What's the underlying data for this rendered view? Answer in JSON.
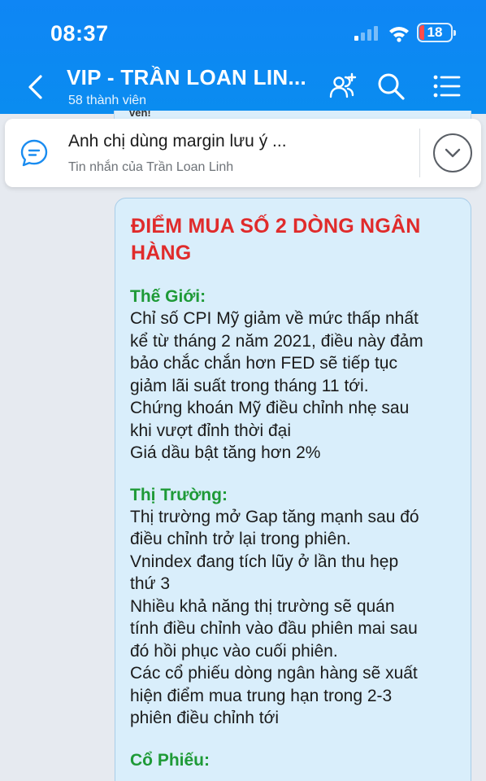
{
  "status_bar": {
    "time": "08:37",
    "battery": "18",
    "icons": [
      "cellular-signal-icon",
      "wifi-icon",
      "battery-icon"
    ]
  },
  "header": {
    "back_icon": "chevron-left-icon",
    "title": "VIP - TRẦN LOAN LIN...",
    "subtitle": "58 thành viên",
    "actions": [
      "add-member-icon",
      "search-icon",
      "menu-icon"
    ],
    "color": "#0f86f5"
  },
  "pinned_message": {
    "peek_text": "veh!",
    "text": "Anh chị dùng margin lưu ý ...",
    "sender": "Tin nhắn của Trần Loan Linh",
    "icon": "chat-bubble-icon",
    "expand_icon": "chevron-down-icon"
  },
  "message": {
    "title": "ĐIỂM MUA SỐ 2 DÒNG NGÂN HÀNG",
    "title_color": "#e02b2b",
    "section_color": "#1e9a37",
    "sections": [
      {
        "heading": "Thế Giới:",
        "lines": [
          "Chỉ số CPI Mỹ giảm về mức thấp nhất",
          "kể từ tháng 2 năm 2021, điều này đảm",
          "bảo chắc chắn hơn FED sẽ tiếp tục",
          "giảm lãi suất trong tháng 11 tới.",
          "Chứng khoán Mỹ điều chỉnh nhẹ sau",
          "khi vượt đỉnh thời đại",
          "Giá dầu bật tăng hơn 2%"
        ]
      },
      {
        "heading": "Thị Trường:",
        "lines": [
          "Thị trường mở Gap tăng mạnh sau đó",
          "điều chỉnh trở lại trong phiên.",
          "Vnindex đang tích lũy ở lần thu hẹp",
          "thứ 3",
          "Nhiều khả năng thị trường sẽ  quán",
          "tính điều chỉnh vào đầu phiên mai sau",
          "đó hồi phục vào cuối phiên.",
          "Các cổ phiếu dòng ngân hàng sẽ xuất",
          "hiện điểm mua trung hạn trong 2-3",
          "phiên điều chỉnh tới"
        ]
      },
      {
        "heading": "Cổ Phiếu:",
        "lines": []
      }
    ]
  }
}
